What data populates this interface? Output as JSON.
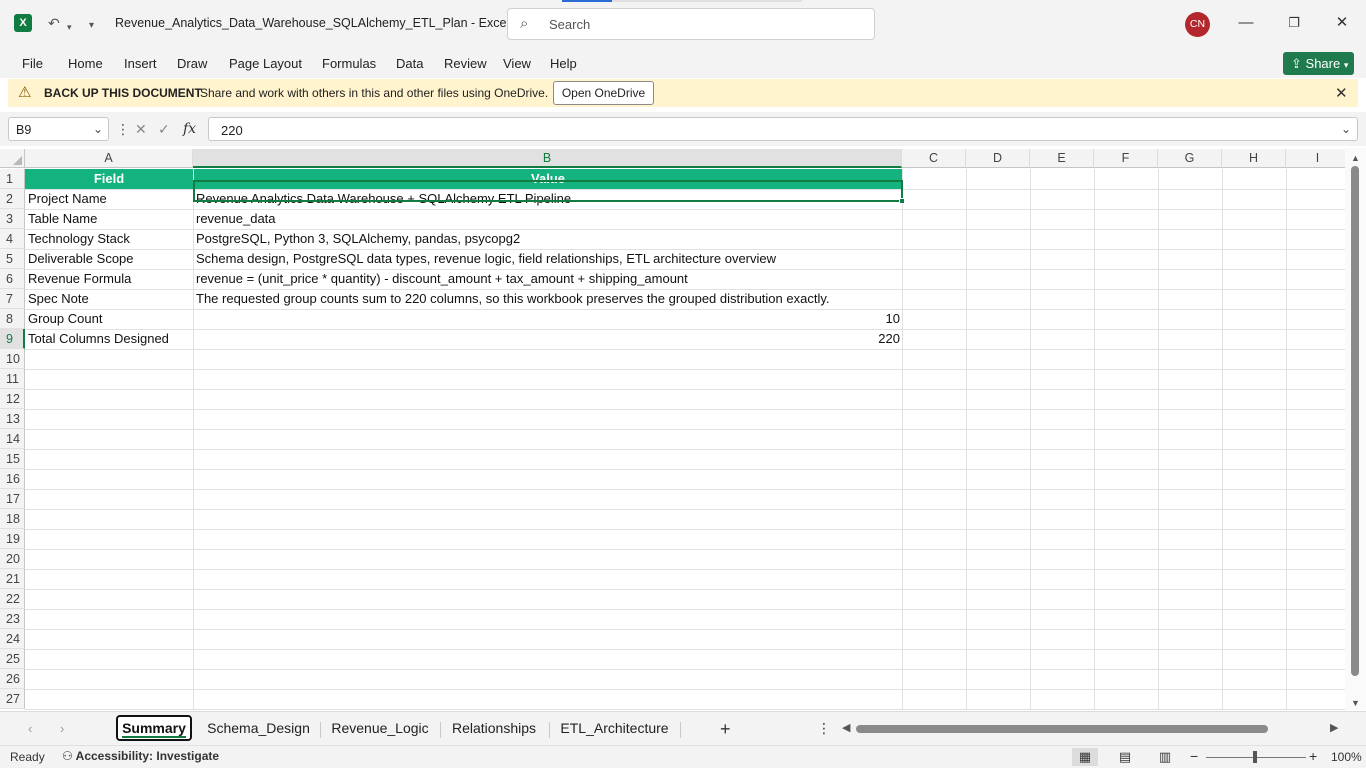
{
  "titlebar": {
    "app_icon": "excel-icon",
    "doc_title": "Revenue_Analytics_Data_Warehouse_SQLAlchemy_ETL_Plan  -  Excel",
    "search_placeholder": "Search",
    "avatar_initials": "CN"
  },
  "ribbon": {
    "tabs": [
      "File",
      "Home",
      "Insert",
      "Draw",
      "Page Layout",
      "Formulas",
      "Data",
      "Review",
      "View",
      "Help"
    ],
    "share_label": "Share"
  },
  "message_bar": {
    "title": "BACK UP THIS DOCUMENT",
    "text": "Share and work with others in this and other files using OneDrive.",
    "button": "Open OneDrive"
  },
  "formula_bar": {
    "name_box": "B9",
    "fx_label": "fx",
    "value": "220"
  },
  "grid": {
    "columns": [
      "A",
      "B",
      "C",
      "D",
      "E",
      "F",
      "G",
      "H",
      "I"
    ],
    "rows": [
      "1",
      "2",
      "3",
      "4",
      "5",
      "6",
      "7",
      "8",
      "9",
      "10",
      "11",
      "12",
      "13",
      "14",
      "15",
      "16",
      "17",
      "18",
      "19",
      "20",
      "21",
      "22",
      "23",
      "24",
      "25",
      "26",
      "27"
    ],
    "header": {
      "a": "Field",
      "b": "Value"
    },
    "data": [
      {
        "a": "Project Name",
        "b": "Revenue Analytics Data Warehouse + SQLAlchemy ETL Pipeline"
      },
      {
        "a": "Table Name",
        "b": "revenue_data"
      },
      {
        "a": "Technology Stack",
        "b": "PostgreSQL, Python 3, SQLAlchemy, pandas, psycopg2"
      },
      {
        "a": "Deliverable Scope",
        "b": "Schema design, PostgreSQL data types, revenue logic, field relationships, ETL architecture overview"
      },
      {
        "a": "Revenue Formula",
        "b": "revenue = (unit_price * quantity) - discount_amount + tax_amount + shipping_amount"
      },
      {
        "a": "Spec Note",
        "b": "The requested group counts sum to 220 columns, so this workbook preserves the grouped distribution exactly."
      },
      {
        "a": "Group Count",
        "b": "10"
      },
      {
        "a": "Total Columns Designed",
        "b": "220"
      }
    ],
    "selected_cell": "B9",
    "header_color": "#14b27e"
  },
  "sheets": {
    "tabs": [
      "Summary",
      "Schema_Design",
      "Revenue_Logic",
      "Relationships",
      "ETL_Architecture"
    ],
    "active": "Summary"
  },
  "status": {
    "ready": "Ready",
    "accessibility": "Accessibility: Investigate",
    "zoom": "100%"
  }
}
